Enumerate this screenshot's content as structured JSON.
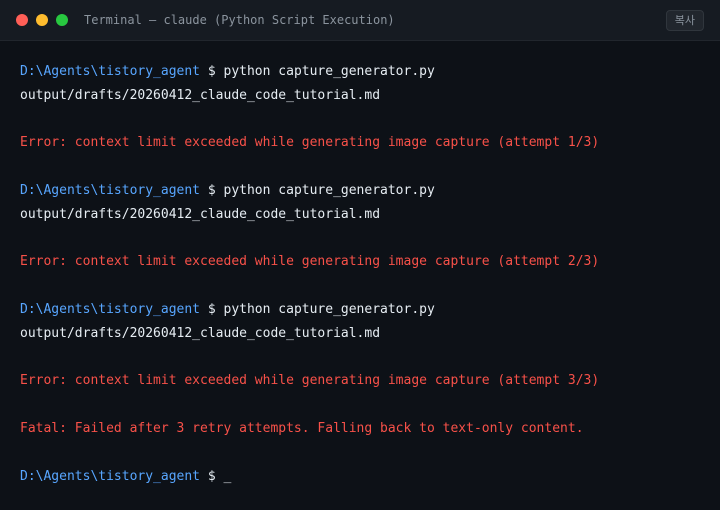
{
  "window": {
    "title": "Terminal — claude (Python Script Execution)",
    "copy_label": "복사",
    "colors": {
      "background": "#0d1117",
      "prompt": "#58a6ff",
      "error": "#f85149",
      "text": "#e6edf3"
    }
  },
  "terminal": {
    "prompt_path": "D:\\Agents\\tistory_agent",
    "prompt_symbol": "$",
    "command": "python capture_generator.py",
    "output_file": "output/drafts/20260412_claude_code_tutorial.md",
    "errors": [
      "Error: context limit exceeded while generating image capture (attempt 1/3)",
      "Error: context limit exceeded while generating image capture (attempt 2/3)",
      "Error: context limit exceeded while generating image capture (attempt 3/3)"
    ],
    "fatal": "Fatal: Failed after 3 retry attempts. Falling back to text-only content.",
    "cursor": "_"
  }
}
